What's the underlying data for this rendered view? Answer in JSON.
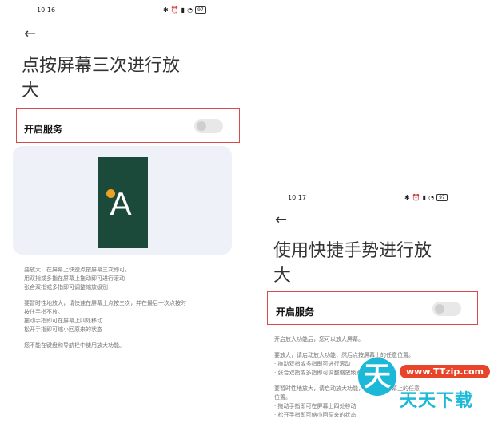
{
  "left": {
    "status": {
      "time": "10:16",
      "battery": "97"
    },
    "back_glyph": "←",
    "title_line1": "点按屏幕三次进行放",
    "title_line2": "大",
    "service_label": "开启服务",
    "card_letter": "A",
    "desc": [
      [
        "要放大，在屏幕上快速点按屏幕三次即可。",
        "用双指或多指在屏幕上拖动即可进行滚动",
        "张合双指或多指即可调整缩放级别"
      ],
      [
        "要暂时性地放大，请快速在屏幕上点按三次，并在最后一次点按时",
        "按住手指不放。",
        "拖动手指即可在屏幕上四处移动",
        "松开手指即可缩小回原来的状态"
      ],
      [
        "您不能在键盘和导航栏中使用放大功能。"
      ]
    ]
  },
  "right": {
    "status": {
      "time": "10:17",
      "battery": "97"
    },
    "back_glyph": "←",
    "title_line1": "使用快捷手势进行放",
    "title_line2": "大",
    "service_label": "开启服务",
    "desc": [
      [
        "开启放大功能后，您可以放大屏幕。"
      ],
      [
        "要放大，请启动放大功能，然后点按屏幕上的任意位置。",
        "· 拖动双指或多指即可进行滚动",
        "· 张合双指或多指即可调整缩放级别"
      ],
      [
        "要暂时性地放大，请启动放大功能，然后轻触屏幕上的任意",
        "位置。",
        "· 拖动手指即可在屏幕上四处移动",
        "· 松开手指即可缩小回原来的状态"
      ]
    ]
  },
  "watermark": {
    "char": "天",
    "url": "www.TTzip.com",
    "text": "天天下载"
  }
}
